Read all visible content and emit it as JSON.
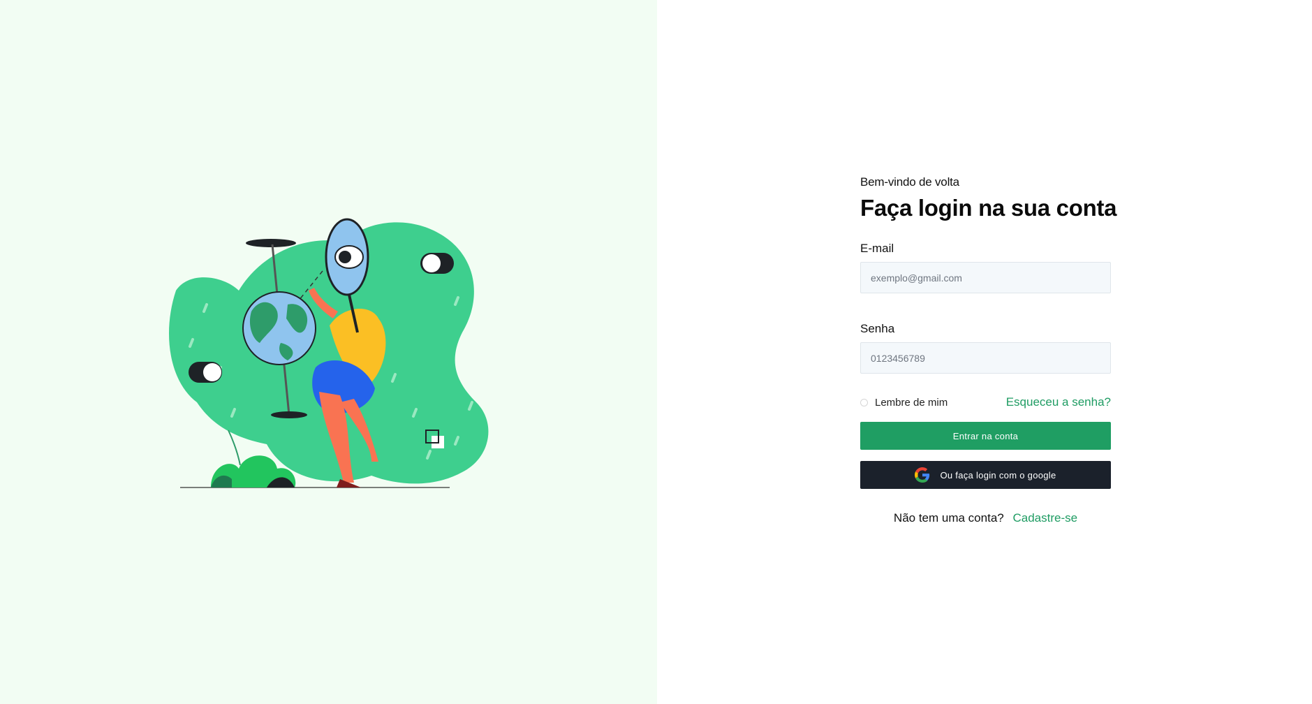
{
  "colors": {
    "left_background": "#f2fdf3",
    "accent_green": "#1f9e63",
    "google_button_bg": "#1b212b",
    "illustration_blob": "#3ecf8e"
  },
  "illustration": {
    "name": "person-with-magnifier-and-globe"
  },
  "login": {
    "welcome": "Bem-vindo de volta",
    "title": "Faça login na sua conta",
    "email_label": "E-mail",
    "email_placeholder": "exemplo@gmail.com",
    "email_value": "",
    "password_label": "Senha",
    "password_placeholder": "0123456789",
    "password_value": "",
    "remember_label": "Lembre de mim",
    "remember_checked": false,
    "forgot_label": "Esqueceu a senha?",
    "submit_label": "Entrar na conta",
    "google_label": "Ou faça login com o google",
    "google_icon": "google-logo-icon",
    "no_account_text": "Não tem uma conta?",
    "signup_label": "Cadastre-se"
  }
}
